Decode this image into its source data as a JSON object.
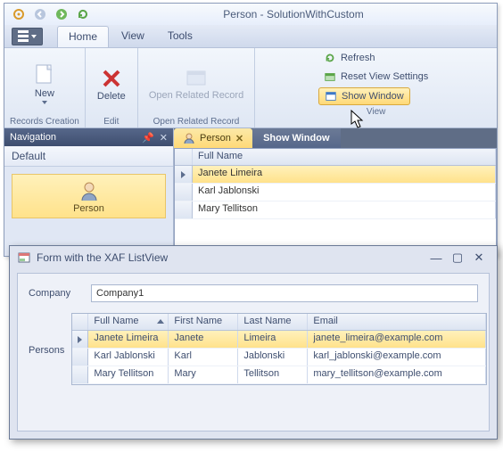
{
  "app": {
    "title": "Person - SolutionWithCustom"
  },
  "tabs": {
    "home": "Home",
    "view": "View",
    "tools": "Tools"
  },
  "ribbon": {
    "records_creation": {
      "label": "Records Creation",
      "new": "New"
    },
    "edit": {
      "label": "Edit",
      "delete": "Delete"
    },
    "open_related": {
      "label": "Open Related Record",
      "btn": "Open Related\nRecord"
    },
    "view": {
      "label": "View",
      "refresh": "Refresh",
      "reset": "Reset View Settings",
      "show_window": "Show Window"
    }
  },
  "nav": {
    "title": "Navigation",
    "group": "Default",
    "item": "Person"
  },
  "doctabs": {
    "person": "Person",
    "show_window": "Show Window"
  },
  "grid": {
    "header": "Full Name",
    "rows": [
      "Janete Limeira",
      "Karl Jablonski",
      "Mary Tellitson"
    ]
  },
  "popup": {
    "title": "Form with the XAF ListView",
    "company_label": "Company",
    "company_value": "Company1",
    "persons_label": "Persons",
    "columns": {
      "full": "Full Name",
      "first": "First Name",
      "last": "Last Name",
      "email": "Email"
    },
    "rows": [
      {
        "full": "Janete Limeira",
        "first": "Janete",
        "last": "Limeira",
        "email": "janete_limeira@example.com"
      },
      {
        "full": "Karl Jablonski",
        "first": "Karl",
        "last": "Jablonski",
        "email": "karl_jablonski@example.com"
      },
      {
        "full": "Mary Tellitson",
        "first": "Mary",
        "last": "Tellitson",
        "email": "mary_tellitson@example.com"
      }
    ]
  }
}
